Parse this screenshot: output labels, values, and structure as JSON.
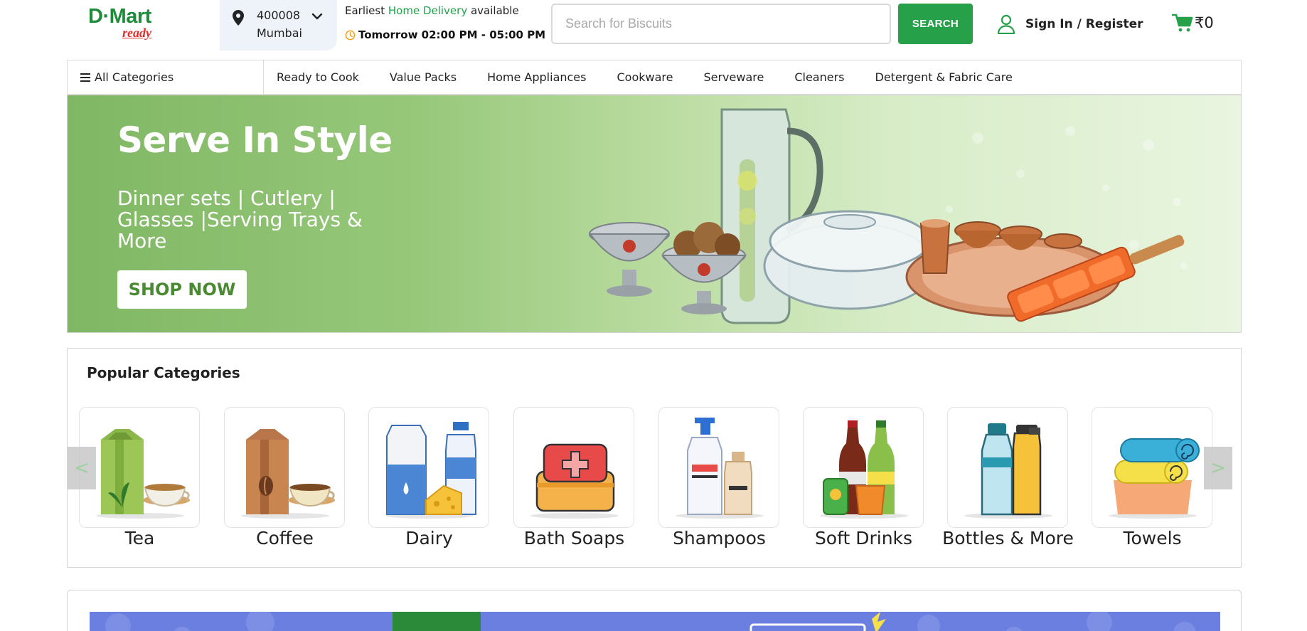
{
  "header": {
    "logo": {
      "top": "D·Mart",
      "bottom": "ready"
    },
    "location": {
      "pincode": "400008",
      "city": "Mumbai"
    },
    "delivery": {
      "prefix": "Earliest ",
      "highlight": "Home Delivery",
      "suffix": " available",
      "slot": "Tomorrow 02:00 PM - 05:00 PM"
    },
    "search": {
      "placeholder": "Search for Biscuits",
      "value": "",
      "button": "SEARCH"
    },
    "signin": "Sign In / Register",
    "cart_total": "₹0"
  },
  "nav": {
    "all_categories": "All Categories",
    "items": [
      "Ready to Cook",
      "Value Packs",
      "Home Appliances",
      "Cookware",
      "Serveware",
      "Cleaners",
      "Detergent & Fabric Care"
    ]
  },
  "banner": {
    "title": "Serve In Style",
    "subtitle": "Dinner sets | Cutlery | Glasses |Serving Trays & More",
    "button": "SHOP NOW"
  },
  "popular": {
    "title": "Popular Categories",
    "prev": "<",
    "next": ">",
    "items": [
      {
        "label": "Tea",
        "icon": "tea-icon"
      },
      {
        "label": "Coffee",
        "icon": "coffee-icon"
      },
      {
        "label": "Dairy",
        "icon": "dairy-icon"
      },
      {
        "label": "Bath Soaps",
        "icon": "soap-icon"
      },
      {
        "label": "Shampoos",
        "icon": "shampoo-icon"
      },
      {
        "label": "Soft Drinks",
        "icon": "soft-drinks-icon"
      },
      {
        "label": "Bottles & More",
        "icon": "bottles-icon"
      },
      {
        "label": "Towels",
        "icon": "towels-icon"
      }
    ]
  },
  "colors": {
    "brand_green": "#27a04a",
    "highlight_green": "#1fa049",
    "brand_red": "#e42b2b"
  }
}
